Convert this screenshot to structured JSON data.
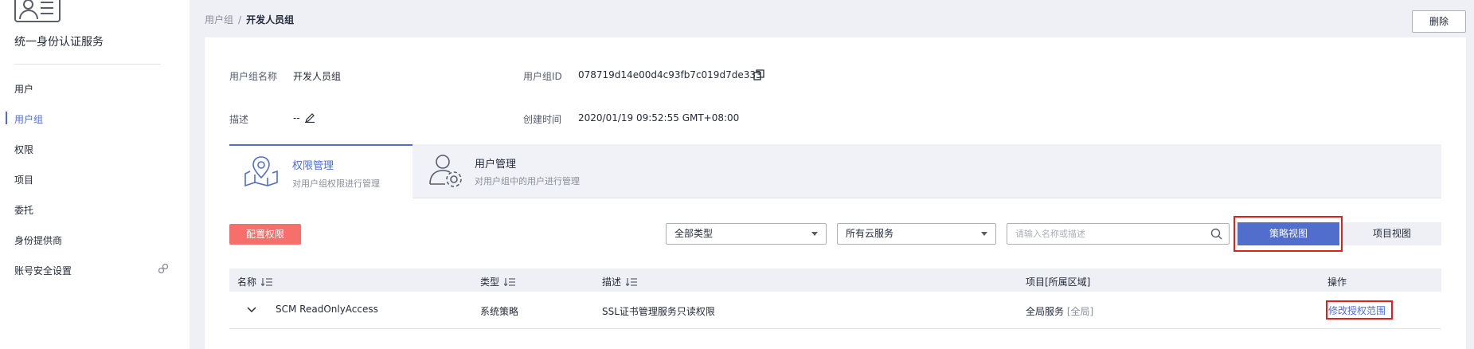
{
  "sidebar": {
    "title": "统一身份认证服务",
    "logo_icon": "id-card-icon",
    "items": [
      {
        "label": "用户",
        "active": false
      },
      {
        "label": "用户组",
        "active": true
      },
      {
        "label": "权限",
        "active": false
      },
      {
        "label": "项目",
        "active": false
      },
      {
        "label": "委托",
        "active": false
      },
      {
        "label": "身份提供商",
        "active": false
      },
      {
        "label": "账号安全设置",
        "active": false,
        "icon": "link-icon"
      }
    ]
  },
  "breadcrumb": {
    "parent": "用户组",
    "separator": "/",
    "current": "开发人员组"
  },
  "header": {
    "delete_label": "删除"
  },
  "group_info": {
    "name_label": "用户组名称",
    "name_value": "开发人员组",
    "id_label": "用户组ID",
    "id_value": "078719d14e00d4c93fb7c019d7de333",
    "desc_label": "描述",
    "desc_value": "--",
    "created_label": "创建时间",
    "created_value": "2020/01/19 09:52:55 GMT+08:00"
  },
  "tabs": [
    {
      "title": "权限管理",
      "desc": "对用户组权限进行管理",
      "icon": "map-pin-icon",
      "active": true
    },
    {
      "title": "用户管理",
      "desc": "对用户组中的用户进行管理",
      "icon": "user-settings-icon",
      "active": false
    }
  ],
  "toolbar": {
    "configure_label": "配置权限",
    "type_select": "全部类型",
    "service_select": "所有云服务",
    "search_placeholder": "请输入名称或描述",
    "policy_view_label": "策略视图",
    "project_view_label": "项目视图"
  },
  "table": {
    "headers": {
      "name": "名称",
      "type": "类型",
      "desc": "描述",
      "project": "项目[所属区域]",
      "action": "操作"
    },
    "rows": [
      {
        "name": "SCM ReadOnlyAccess",
        "type": "系统策略",
        "desc": "SSL证书管理服务只读权限",
        "project": "全局服务",
        "project_region": "[全局]",
        "action": "修改授权范围"
      }
    ]
  },
  "colors": {
    "accent": "#526ecc",
    "danger_button": "#f66f6a",
    "highlight_border": "#e0201c"
  }
}
